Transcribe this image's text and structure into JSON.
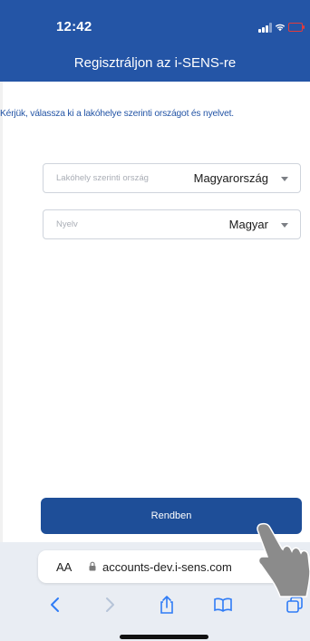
{
  "status_bar": {
    "time": "12:42"
  },
  "header": {
    "title": "Regisztráljon az i-SENS-re"
  },
  "instruction": "Kérjük, válassza ki a lakóhelye szerinti országot és nyelvet.",
  "fields": {
    "country": {
      "label": "Lakóhely szerinti ország",
      "value": "Magyarország"
    },
    "language": {
      "label": "Nyelv",
      "value": "Magyar"
    }
  },
  "ok_button": {
    "label": "Rendben"
  },
  "browser": {
    "aa_label": "AA",
    "url": "accounts-dev.i-sens.com"
  },
  "colors": {
    "brand": "#2455a6",
    "button": "#1e4e98",
    "battery": "#e23b3b",
    "toolbar_icon": "#2f7cf6"
  }
}
